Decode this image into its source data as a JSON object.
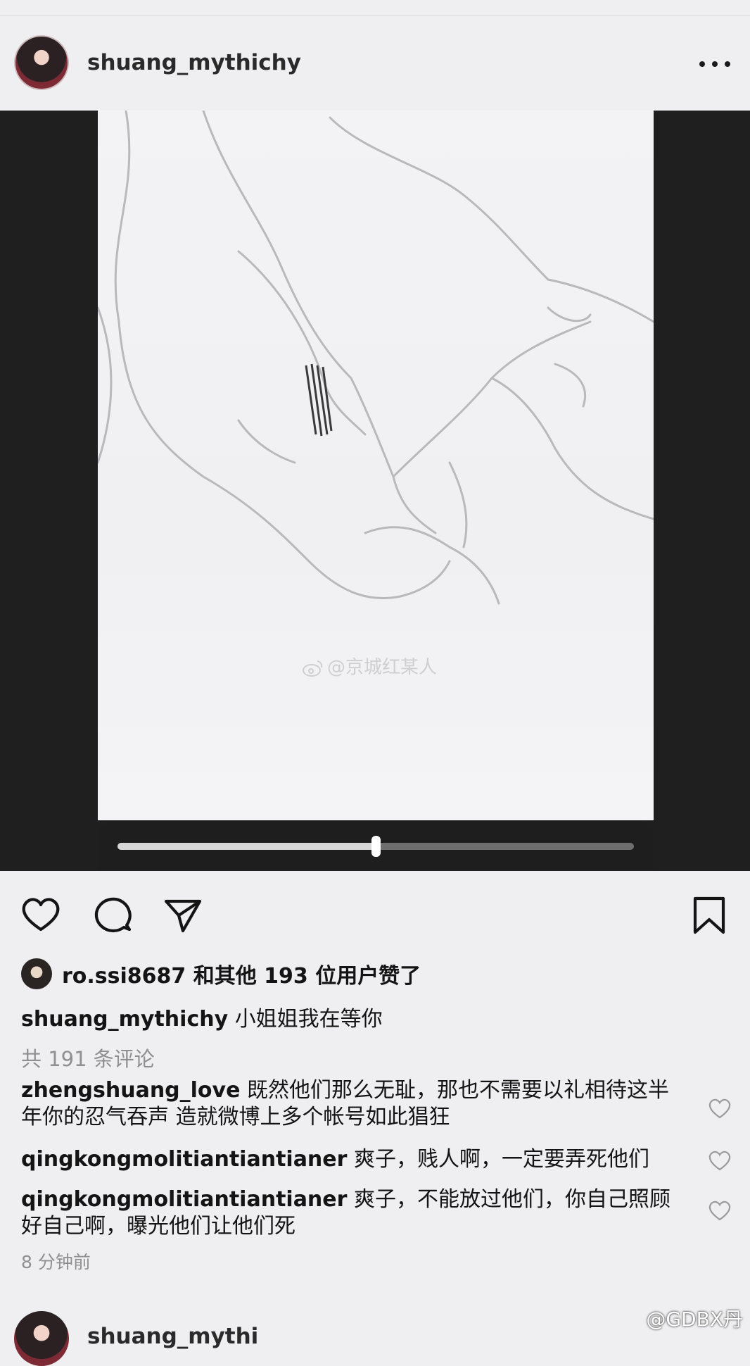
{
  "post": {
    "username": "shuang_mythichy",
    "more_icon": "more-horizontal-icon"
  },
  "media": {
    "watermark": "@京城红某人",
    "progress": 0.5
  },
  "actions": {
    "like_icon": "heart-icon",
    "comment_icon": "comment-icon",
    "share_icon": "send-icon",
    "save_icon": "bookmark-icon"
  },
  "likes": {
    "text": "ro.ssi8687 和其他 193 位用户赞了"
  },
  "caption": {
    "user": "shuang_mythichy",
    "text": "小姐姐我在等你"
  },
  "comments_count": "共 191 条评论",
  "comments": [
    {
      "user": "zhengshuang_love",
      "text": "既然他们那么无耻，那也不需要以礼相待这半年你的忍气吞声 造就微博上多个帐号如此猖狂"
    },
    {
      "user": "qingkongmolitiantiantianer",
      "text": "爽子，贱人啊，一定要弄死他们"
    },
    {
      "user": "qingkongmolitiantiantianer",
      "text": "爽子，不能放过他们，你自己照顾好自己啊，曝光他们让他们死"
    }
  ],
  "timestamp": "8 分钟前",
  "next_post": {
    "username": "shuang_mythi"
  },
  "page_watermark": "@GDBX丹"
}
